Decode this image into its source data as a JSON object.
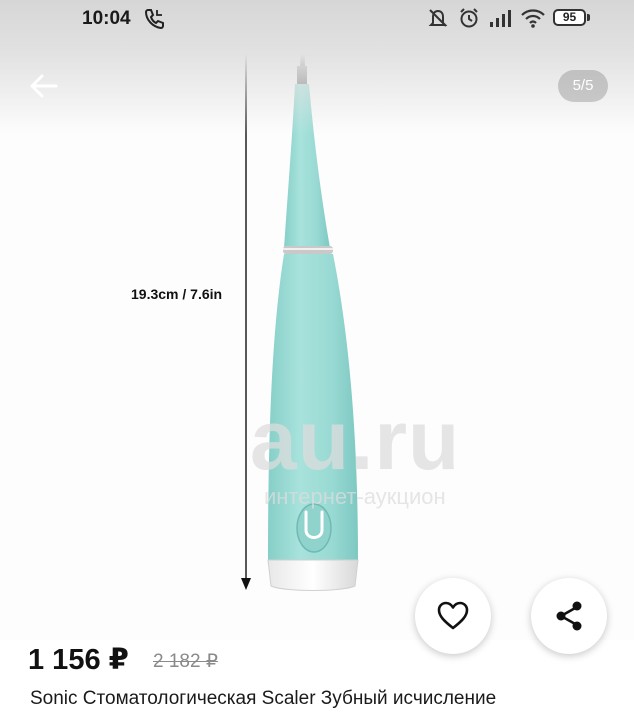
{
  "status_bar": {
    "time": "10:04",
    "battery": "95",
    "icons": [
      "call-icon",
      "mute-icon",
      "alarm-icon",
      "signal-icon",
      "wifi-icon",
      "battery-icon"
    ]
  },
  "toolbar": {
    "back_icon": "arrow-back-icon",
    "page_counter": "5/5"
  },
  "image": {
    "dimension_label": "19.3cm / 7.6in",
    "watermark_logo": "au.ru",
    "watermark_sub": "интернет-аукцион"
  },
  "actions": {
    "favorite_icon": "heart-icon",
    "share_icon": "share-icon"
  },
  "product": {
    "price": "1 156 ₽",
    "old_price": "2 182 ₽",
    "title": "Sonic Стоматологическая Scaler Зубный исчисление"
  },
  "colors": {
    "device_body": "#9fdcd6",
    "device_shade": "#7ec8c2",
    "top_shade": "#d6d6d6",
    "text_primary": "#111111",
    "text_muted": "#8a8a8a"
  }
}
